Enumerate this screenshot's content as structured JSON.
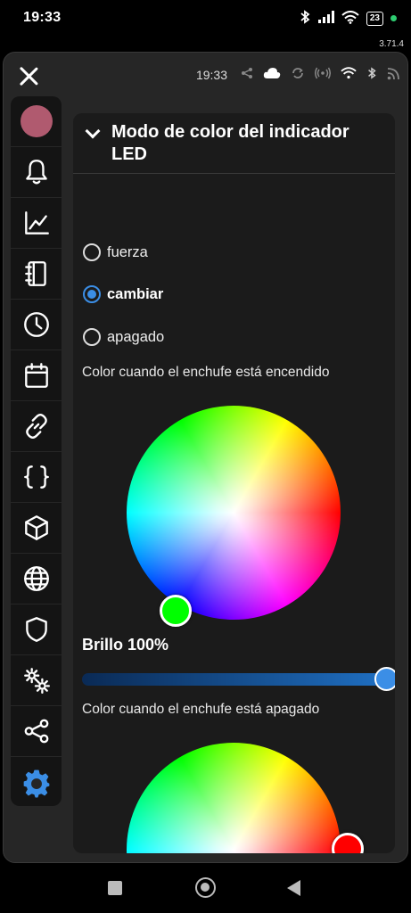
{
  "status_bar": {
    "time": "19:33",
    "battery": "23",
    "version": "3.71.4",
    "icons": [
      "bluetooth-icon",
      "signal-icon",
      "wifi-icon",
      "battery-icon"
    ]
  },
  "app_topbar": {
    "time": "19:33",
    "icons": [
      "share-icon",
      "cloud-icon",
      "sync-icon",
      "broadcast-icon",
      "wifi-icon",
      "bluetooth-icon",
      "rss-icon"
    ]
  },
  "sidebar": {
    "items": [
      {
        "name": "avatar",
        "icon": "avatar"
      },
      {
        "name": "notifications",
        "icon": "bell-icon"
      },
      {
        "name": "statistics",
        "icon": "chart-icon"
      },
      {
        "name": "notebook",
        "icon": "notebook-icon"
      },
      {
        "name": "schedule",
        "icon": "clock-icon"
      },
      {
        "name": "calendar",
        "icon": "calendar-icon"
      },
      {
        "name": "links",
        "icon": "link-icon"
      },
      {
        "name": "code",
        "icon": "braces-icon",
        "glyph": "{ }"
      },
      {
        "name": "device",
        "icon": "cube-icon"
      },
      {
        "name": "network",
        "icon": "globe-icon"
      },
      {
        "name": "security",
        "icon": "shield-icon"
      },
      {
        "name": "advanced-settings",
        "icon": "gears-icon"
      },
      {
        "name": "share",
        "icon": "share-icon"
      },
      {
        "name": "settings",
        "icon": "gear-icon",
        "active": true
      }
    ]
  },
  "panel": {
    "title": "Modo de color del indicador LED",
    "options": [
      {
        "label": "fuerza",
        "checked": false
      },
      {
        "label": "cambiar",
        "checked": true
      },
      {
        "label": "apagado",
        "checked": false
      }
    ],
    "color_on_label": "Color cuando el enchufe está encendido",
    "color_on_value": "#00ff00",
    "brightness_label": "Brillo 100%",
    "brightness_value": 1.0,
    "color_off_label": "Color cuando el enchufe está apagado",
    "color_off_value": "#ff0000"
  },
  "colors": {
    "accent": "#3b8ee6",
    "panel_bg": "#1b1b1b",
    "window_bg": "#262626"
  },
  "nav_bar": {
    "buttons": [
      "recents-button",
      "home-button",
      "back-button"
    ]
  }
}
